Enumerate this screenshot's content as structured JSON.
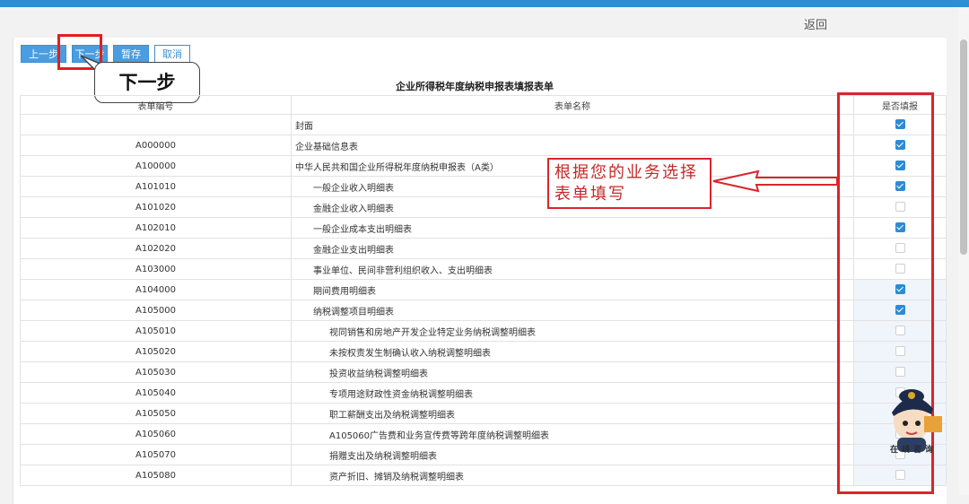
{
  "header": {
    "back_label": "返回"
  },
  "toolbar": {
    "prev": "上一步",
    "next": "下一步",
    "save": "暂存",
    "cancel": "取消"
  },
  "callout": {
    "text": "下一步"
  },
  "form": {
    "title": "企业所得税年度纳税申报表填报表单",
    "columns": [
      "表单编号",
      "表单名称",
      "是否填报"
    ],
    "rows": [
      {
        "code": "",
        "name": "封面",
        "indent": 0,
        "checked": true
      },
      {
        "code": "A000000",
        "name": "企业基础信息表",
        "indent": 0,
        "checked": true
      },
      {
        "code": "A100000",
        "name": "中华人民共和国企业所得税年度纳税申报表（A类）",
        "indent": 0,
        "checked": true
      },
      {
        "code": "A101010",
        "name": "一般企业收入明细表",
        "indent": 1,
        "checked": true
      },
      {
        "code": "A101020",
        "name": "金融企业收入明细表",
        "indent": 1,
        "checked": false
      },
      {
        "code": "A102010",
        "name": "一般企业成本支出明细表",
        "indent": 1,
        "checked": true
      },
      {
        "code": "A102020",
        "name": "金融企业支出明细表",
        "indent": 1,
        "checked": false
      },
      {
        "code": "A103000",
        "name": "事业单位、民间非营利组织收入、支出明细表",
        "indent": 1,
        "checked": false
      },
      {
        "code": "A104000",
        "name": "期间费用明细表",
        "indent": 1,
        "checked": true
      },
      {
        "code": "A105000",
        "name": "纳税调整项目明细表",
        "indent": 1,
        "checked": true
      },
      {
        "code": "A105010",
        "name": "视同销售和房地产开发企业特定业务纳税调整明细表",
        "indent": 2,
        "checked": false
      },
      {
        "code": "A105020",
        "name": "未按权责发生制确认收入纳税调整明细表",
        "indent": 2,
        "checked": false
      },
      {
        "code": "A105030",
        "name": "投资收益纳税调整明细表",
        "indent": 2,
        "checked": false
      },
      {
        "code": "A105040",
        "name": "专项用途财政性资金纳税调整明细表",
        "indent": 2,
        "checked": false
      },
      {
        "code": "A105050",
        "name": "职工薪酬支出及纳税调整明细表",
        "indent": 2,
        "checked": true
      },
      {
        "code": "A105060",
        "name": "A105060广告费和业务宣传费等跨年度纳税调整明细表",
        "indent": 2,
        "checked": false
      },
      {
        "code": "A105070",
        "name": "捐赠支出及纳税调整明细表",
        "indent": 2,
        "checked": false
      },
      {
        "code": "A105080",
        "name": "资产折旧、摊销及纳税调整明细表",
        "indent": 2,
        "checked": false
      }
    ]
  },
  "annotation": {
    "line1": "根据您的业务选择",
    "line2": "表单填写"
  },
  "watermark": {
    "text": "在线咨询"
  },
  "colors": {
    "accent": "#2b8fd8",
    "highlight": "#d9262c"
  }
}
